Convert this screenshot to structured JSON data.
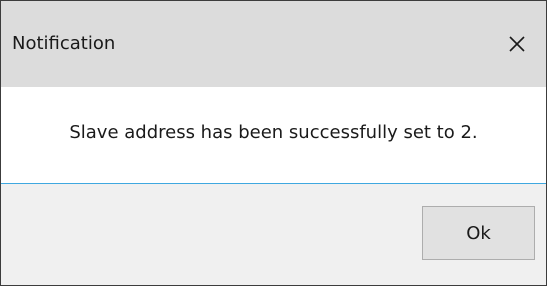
{
  "dialog": {
    "title": "Notification",
    "close_icon": "close-icon",
    "message": "Slave address has been successfully set to 2.",
    "ok_label": "Ok"
  },
  "colors": {
    "titlebar": "#dcdcdc",
    "body": "#ffffff",
    "footer": "#f0f0f0",
    "separator": "#3fa8e0",
    "button": "#e1e1e1"
  }
}
